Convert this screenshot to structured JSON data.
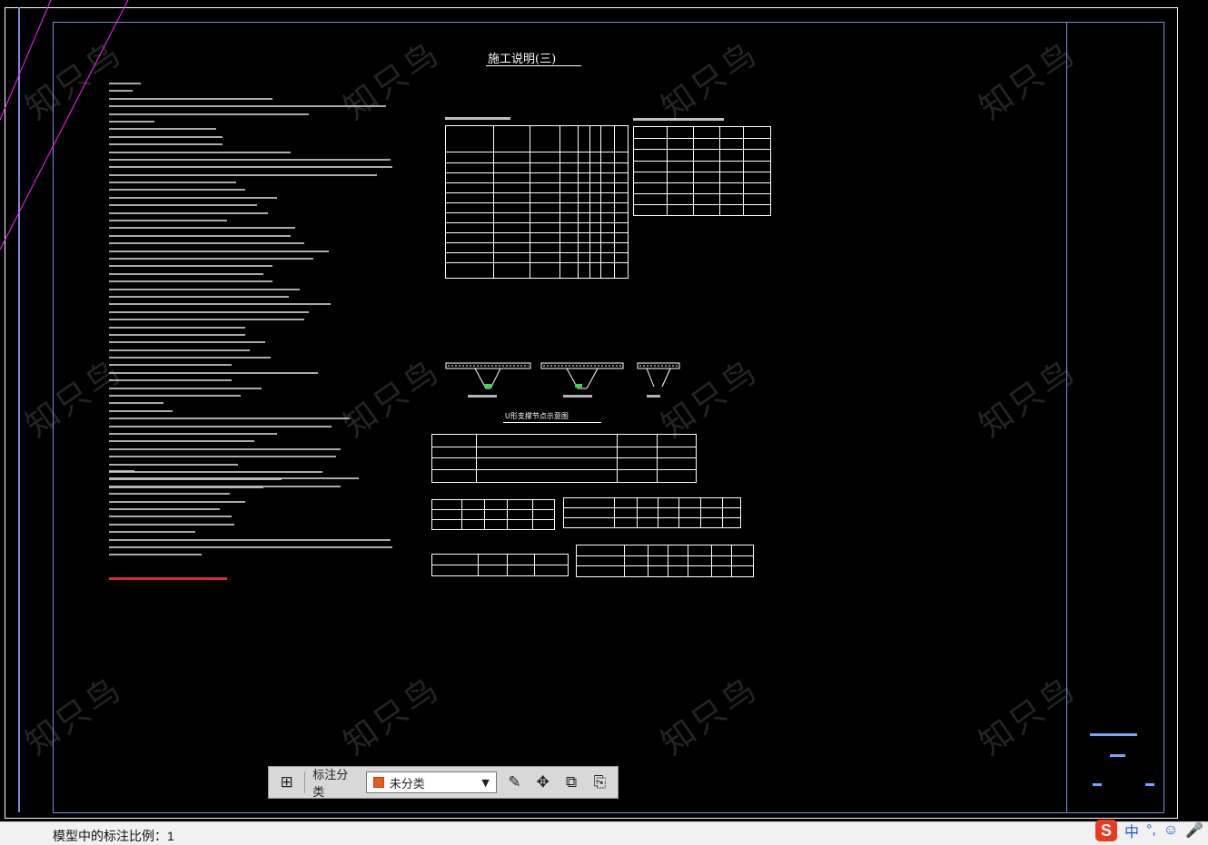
{
  "drawing": {
    "title": "施工说明(三)",
    "joint_title": "U形支撑节点示意图",
    "watermark": "知只鸟"
  },
  "toolbar": {
    "category_label": "标注分类",
    "selected_category": "未分类",
    "icons": {
      "grid": "grid-icon",
      "dropdown": "chevron-down-icon",
      "edit": "edit-icon",
      "move": "move-icon",
      "copy": "copy-icon",
      "paste": "paste-icon"
    }
  },
  "status": {
    "text": "模型中的标注比例：1"
  },
  "ime": {
    "brand": "S",
    "lang": "中",
    "punct": "°,",
    "emoji": "☺",
    "mic": "🎤"
  },
  "colors": {
    "background": "#000000",
    "frame": "#7a8fd8",
    "accent_red": "#ff3b3b",
    "selected_swatch": "#e65a1e"
  }
}
